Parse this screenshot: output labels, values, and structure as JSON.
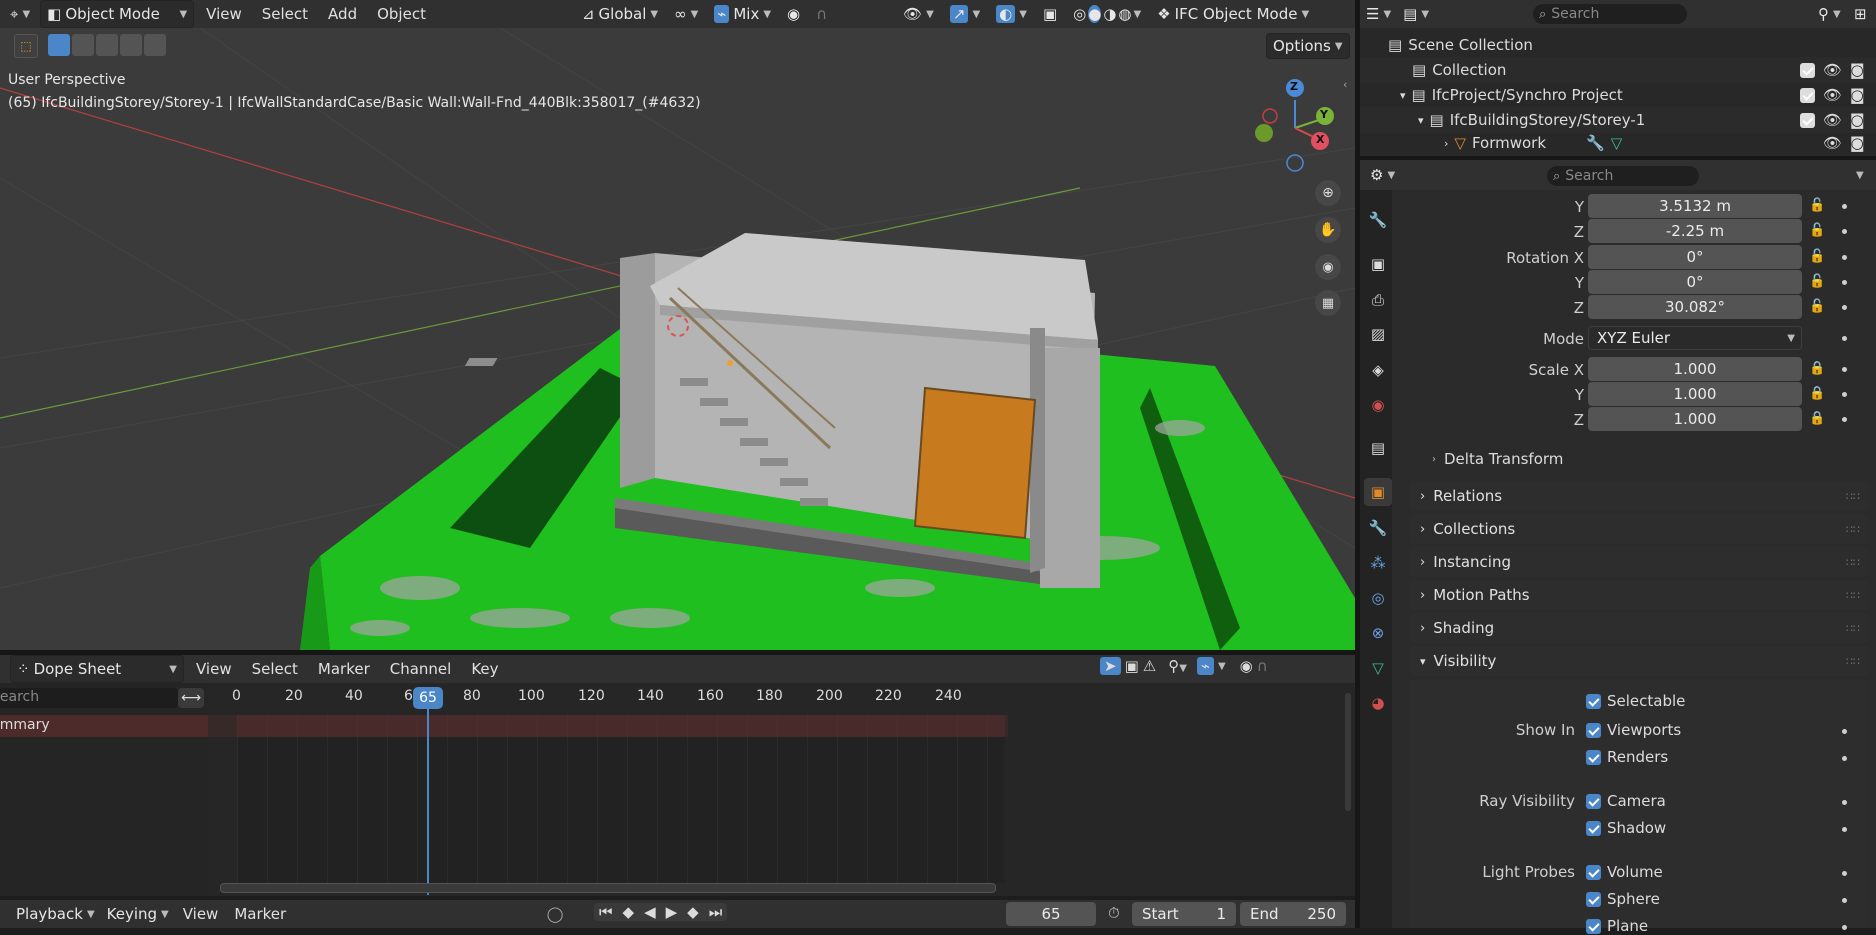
{
  "viewport_header": {
    "mode": "Object Mode",
    "menus": [
      "View",
      "Select",
      "Add",
      "Object"
    ],
    "transform_orientation": "Global",
    "proportional": "Mix",
    "ifc_mode": "IFC Object Mode",
    "options": "Options"
  },
  "viewport": {
    "perspective": "User Perspective",
    "object_info": "(65) IfcBuildingStorey/Storey-1 | IfcWallStandardCase/Basic Wall:Wall-Fnd_440Blk:358017_(#4632)",
    "gizmo_axes": [
      "Z",
      "Y",
      "X"
    ]
  },
  "outliner": {
    "search_placeholder": "Search",
    "items": [
      {
        "label": "Scene Collection"
      },
      {
        "label": "Collection"
      },
      {
        "label": "IfcProject/Synchro Project"
      },
      {
        "label": "IfcBuildingStorey/Storey-1"
      },
      {
        "label": "Formwork"
      }
    ]
  },
  "properties": {
    "search_placeholder": "Search",
    "location": {
      "y_label": "Y",
      "y": "3.5132 m",
      "z_label": "Z",
      "z": "-2.25 m"
    },
    "rotation": {
      "x_label": "Rotation X",
      "x": "0°",
      "y_label": "Y",
      "y": "0°",
      "z_label": "Z",
      "z": "30.082°"
    },
    "mode_label": "Mode",
    "mode": "XYZ Euler",
    "scale": {
      "x_label": "Scale X",
      "x": "1.000",
      "y_label": "Y",
      "y": "1.000",
      "z_label": "Z",
      "z": "1.000"
    },
    "delta_transform": "Delta Transform",
    "panels": [
      "Relations",
      "Collections",
      "Instancing",
      "Motion Paths",
      "Shading",
      "Visibility"
    ],
    "visibility": {
      "selectable": "Selectable",
      "show_in_label": "Show In",
      "viewports": "Viewports",
      "renders": "Renders",
      "ray_visibility_label": "Ray Visibility",
      "camera": "Camera",
      "shadow": "Shadow",
      "light_probes_label": "Light Probes",
      "volume": "Volume",
      "sphere": "Sphere",
      "plane": "Plane"
    }
  },
  "dopesheet": {
    "editor": "Dope Sheet",
    "menus": [
      "View",
      "Select",
      "Marker",
      "Channel",
      "Key"
    ],
    "search_placeholder": "Search",
    "summary": "Summary",
    "ticks": [
      "0",
      "20",
      "40",
      "6",
      "80",
      "100",
      "120",
      "140",
      "160",
      "180",
      "200",
      "220",
      "240"
    ],
    "current_frame": "65"
  },
  "timeline": {
    "menus": [
      "Playback",
      "Keying",
      "View",
      "Marker"
    ],
    "frame": "65",
    "start_label": "Start",
    "start": "1",
    "end_label": "End",
    "end": "250"
  },
  "colors": {
    "accent": "#4a86c8",
    "ground": "#1fbf1f",
    "door": "#c87a1e",
    "header": "#303030"
  }
}
